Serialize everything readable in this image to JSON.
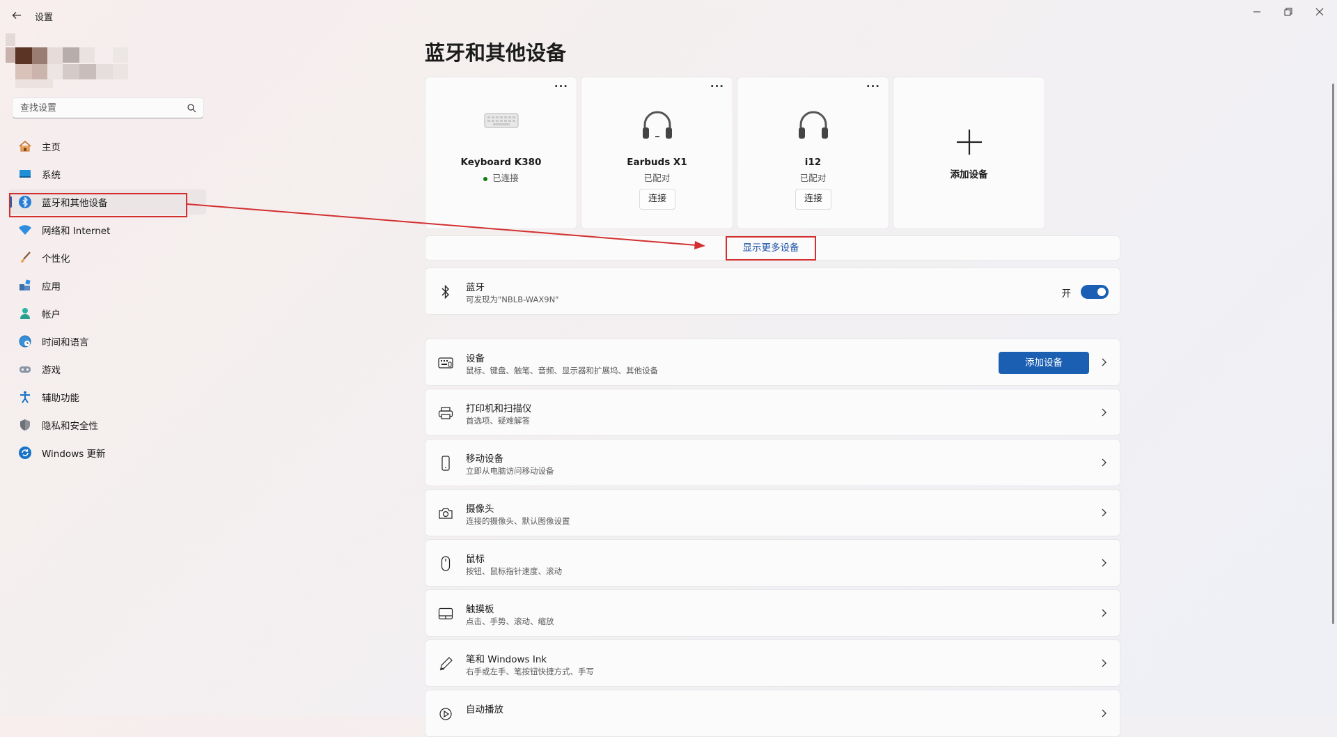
{
  "app": {
    "title": "设置"
  },
  "search": {
    "placeholder": "查找设置"
  },
  "sidebar": {
    "items": [
      {
        "label": "主页",
        "icon": "home-icon"
      },
      {
        "label": "系统",
        "icon": "system-icon"
      },
      {
        "label": "蓝牙和其他设备",
        "icon": "bluetooth-icon",
        "selected": true
      },
      {
        "label": "网络和 Internet",
        "icon": "wifi-icon"
      },
      {
        "label": "个性化",
        "icon": "brush-icon"
      },
      {
        "label": "应用",
        "icon": "apps-icon"
      },
      {
        "label": "帐户",
        "icon": "account-icon"
      },
      {
        "label": "时间和语言",
        "icon": "globe-clock-icon"
      },
      {
        "label": "游戏",
        "icon": "gamepad-icon"
      },
      {
        "label": "辅助功能",
        "icon": "accessibility-icon"
      },
      {
        "label": "隐私和安全性",
        "icon": "shield-icon"
      },
      {
        "label": "Windows 更新",
        "icon": "update-icon"
      }
    ]
  },
  "main": {
    "title": "蓝牙和其他设备",
    "devices": [
      {
        "name": "Keyboard K380",
        "status": "已连接",
        "connected": true,
        "icon": "keyboard-icon"
      },
      {
        "name": "Earbuds X1",
        "status": "已配对",
        "button": "连接",
        "icon": "headphones-icon"
      },
      {
        "name": "i12",
        "status": "已配对",
        "button": "连接",
        "icon": "headphones-icon"
      }
    ],
    "more_glyph": "···",
    "add_device_card": {
      "label": "添加设备"
    },
    "show_more": "显示更多设备",
    "bluetooth": {
      "title": "蓝牙",
      "subtitle": "可发现为\"NBLB-WAX9N\"",
      "state_label": "开",
      "on": true
    },
    "rows": [
      {
        "title": "设备",
        "subtitle": "鼠标、键盘、触笔、音频、显示器和扩展坞、其他设备",
        "icon": "devices-icon",
        "button": "添加设备"
      },
      {
        "title": "打印机和扫描仪",
        "subtitle": "首选项、疑难解答",
        "icon": "printer-icon"
      },
      {
        "title": "移动设备",
        "subtitle": "立即从电脑访问移动设备",
        "icon": "phone-icon"
      },
      {
        "title": "摄像头",
        "subtitle": "连接的摄像头、默认图像设置",
        "icon": "camera-icon"
      },
      {
        "title": "鼠标",
        "subtitle": "按钮、鼠标指针速度、滚动",
        "icon": "mouse-icon"
      },
      {
        "title": "触摸板",
        "subtitle": "点击、手势、滚动、缩放",
        "icon": "touchpad-icon"
      },
      {
        "title": "笔和 Windows Ink",
        "subtitle": "右手或左手、笔按钮快捷方式、手写",
        "icon": "pen-icon"
      },
      {
        "title": "自动播放",
        "subtitle": "",
        "icon": "autoplay-icon"
      }
    ]
  },
  "colors": {
    "accent": "#1a5fb4",
    "annotation": "#d32f2f",
    "connected": "#107c10"
  }
}
